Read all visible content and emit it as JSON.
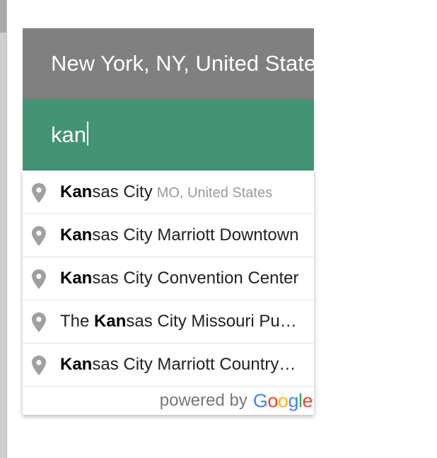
{
  "origin": {
    "value": "New York, NY, United States"
  },
  "destination": {
    "value": "kan"
  },
  "suggestions": [
    {
      "pre": "",
      "match": "Kan",
      "rest": "sas City",
      "secondary": "MO, United States",
      "icon": "map-pin-icon"
    },
    {
      "pre": "",
      "match": "Kan",
      "rest": "sas City Marriott Downtown",
      "secondary": "",
      "icon": "map-pin-icon"
    },
    {
      "pre": "",
      "match": "Kan",
      "rest": "sas City Convention Center",
      "secondary": "",
      "icon": "map-pin-icon"
    },
    {
      "pre": "The ",
      "match": "Kan",
      "rest": "sas City Missouri Public Library",
      "secondary": "",
      "icon": "map-pin-icon"
    },
    {
      "pre": "",
      "match": "Kan",
      "rest": "sas City Marriott Country Club Plaza",
      "secondary": "",
      "icon": "map-pin-icon"
    }
  ],
  "footer": {
    "powered_by": "powered by",
    "logo": [
      "G",
      "o",
      "o",
      "g",
      "l",
      "e"
    ]
  },
  "colors": {
    "origin_bg": "#808080",
    "destination_bg": "#439475",
    "pin": "#a0a0a0",
    "secondary_text": "#9a9a9a"
  }
}
